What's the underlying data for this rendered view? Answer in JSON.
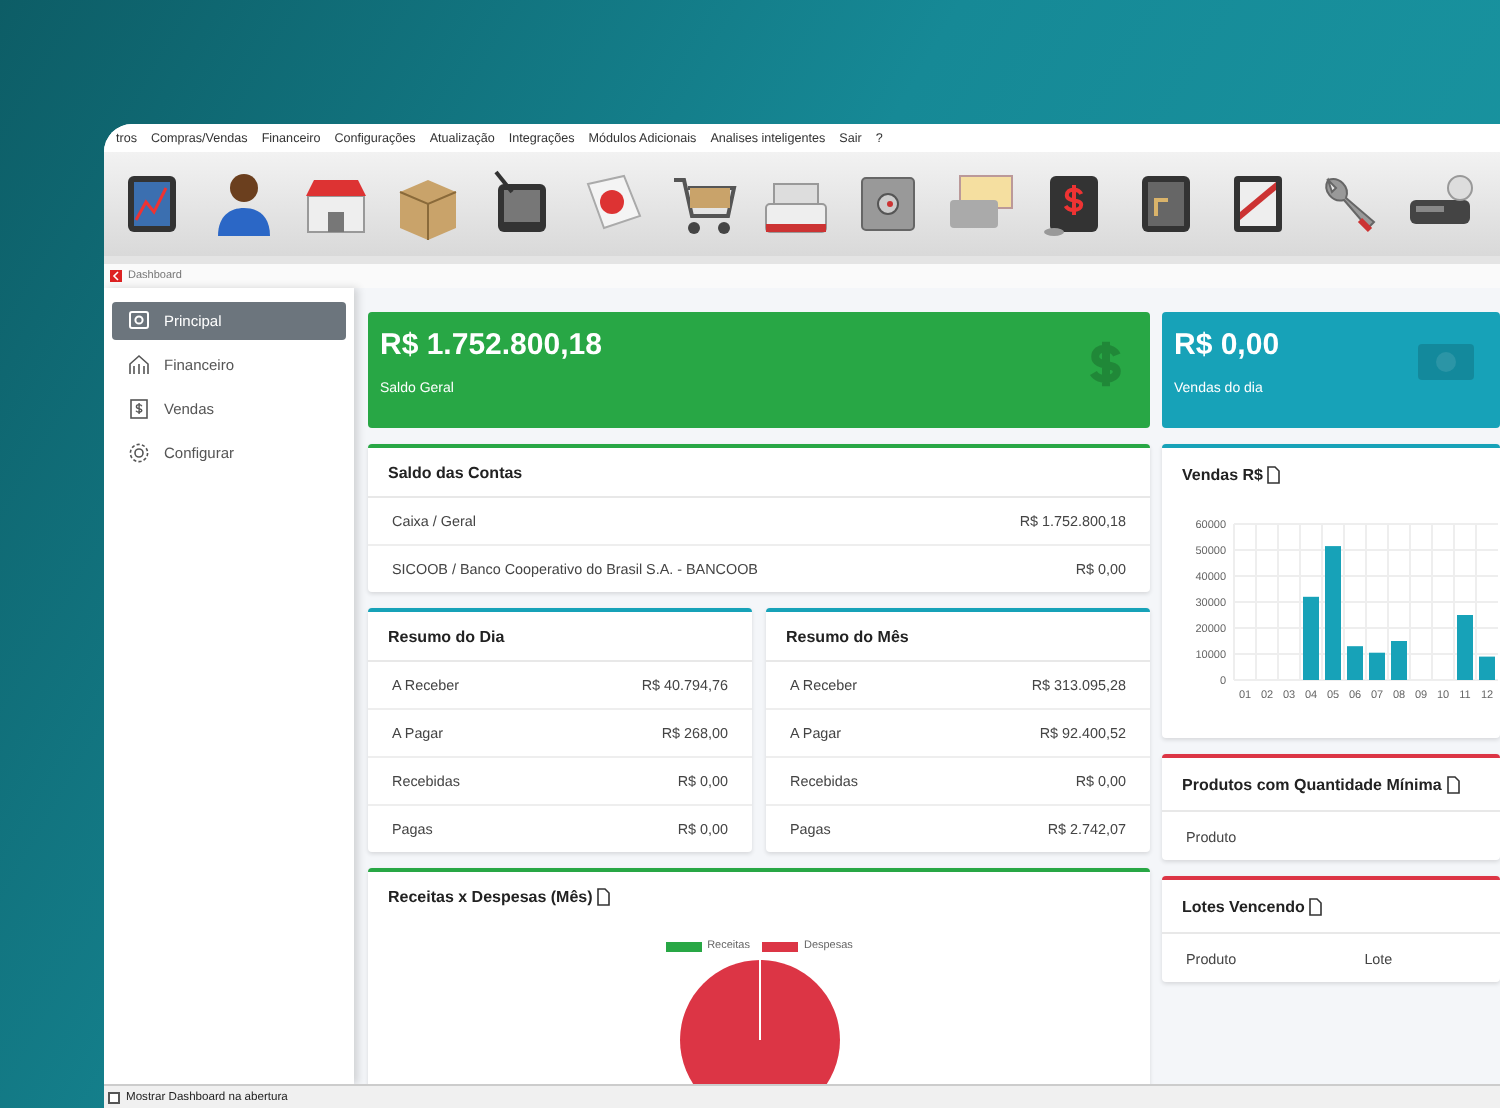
{
  "menu": [
    "tros",
    "Compras/Vendas",
    "Financeiro",
    "Configurações",
    "Atualização",
    "Integrações",
    "Módulos Adicionais",
    "Analises inteligentes",
    "Sair",
    "?"
  ],
  "tab_title": "Dashboard",
  "sidebar": {
    "items": [
      {
        "label": "Principal",
        "selected": true
      },
      {
        "label": "Financeiro",
        "selected": false
      },
      {
        "label": "Vendas",
        "selected": false
      },
      {
        "label": "Configurar",
        "selected": false
      }
    ]
  },
  "stats": [
    {
      "value": "R$ 1.752.800,18",
      "label": "Saldo Geral",
      "color": "#28a745"
    },
    {
      "value": "R$ 0,00",
      "label": "Vendas do dia",
      "color": "#17a2b8"
    }
  ],
  "saldo_contas": {
    "title": "Saldo das Contas",
    "rows": [
      {
        "name": "Caixa / Geral",
        "value": "R$ 1.752.800,18"
      },
      {
        "name": "SICOOB / Banco Cooperativo do Brasil S.A. - BANCOOB",
        "value": "R$ 0,00"
      }
    ]
  },
  "resumo": [
    {
      "title": "Resumo do Dia",
      "rows": [
        {
          "name": "A Receber",
          "value": "R$ 40.794,76"
        },
        {
          "name": "A Pagar",
          "value": "R$ 268,00"
        },
        {
          "name": "Recebidas",
          "value": "R$ 0,00"
        },
        {
          "name": "Pagas",
          "value": "R$ 0,00"
        }
      ]
    },
    {
      "title": "Resumo do Mês",
      "rows": [
        {
          "name": "A Receber",
          "value": "R$ 313.095,28"
        },
        {
          "name": "A Pagar",
          "value": "R$ 92.400,52"
        },
        {
          "name": "Recebidas",
          "value": "R$ 0,00"
        },
        {
          "name": "Pagas",
          "value": "R$ 2.742,07"
        }
      ]
    }
  ],
  "receitas_despesas": {
    "title": "Receitas x Despesas (Mês)",
    "legend": [
      {
        "label": "Receitas",
        "color": "#28a745"
      },
      {
        "label": "Despesas",
        "color": "#dc3545"
      }
    ]
  },
  "vendas": {
    "title": "Vendas R$",
    "chart_data": {
      "type": "bar",
      "categories": [
        "01",
        "02",
        "03",
        "04",
        "05",
        "06",
        "07",
        "08",
        "09",
        "10",
        "11",
        "12"
      ],
      "grid": true,
      "series": [
        {
          "color": "#17a2b8",
          "values": [
            0,
            0,
            0,
            32000,
            51500,
            13000,
            10500,
            15000,
            0,
            0,
            25000,
            9000
          ]
        }
      ],
      "ylim": [
        0,
        60000
      ],
      "yticks": [
        0,
        10000,
        20000,
        30000,
        40000,
        50000,
        60000
      ]
    }
  },
  "produtos_minimos": {
    "title": "Produtos com Quantidade Mínima",
    "columns": [
      "Produto"
    ]
  },
  "lotes": {
    "title": "Lotes Vencendo",
    "columns": [
      "Produto",
      "Lote"
    ]
  },
  "footer": {
    "label": "Mostrar Dashboard na abertura",
    "checked": false
  }
}
